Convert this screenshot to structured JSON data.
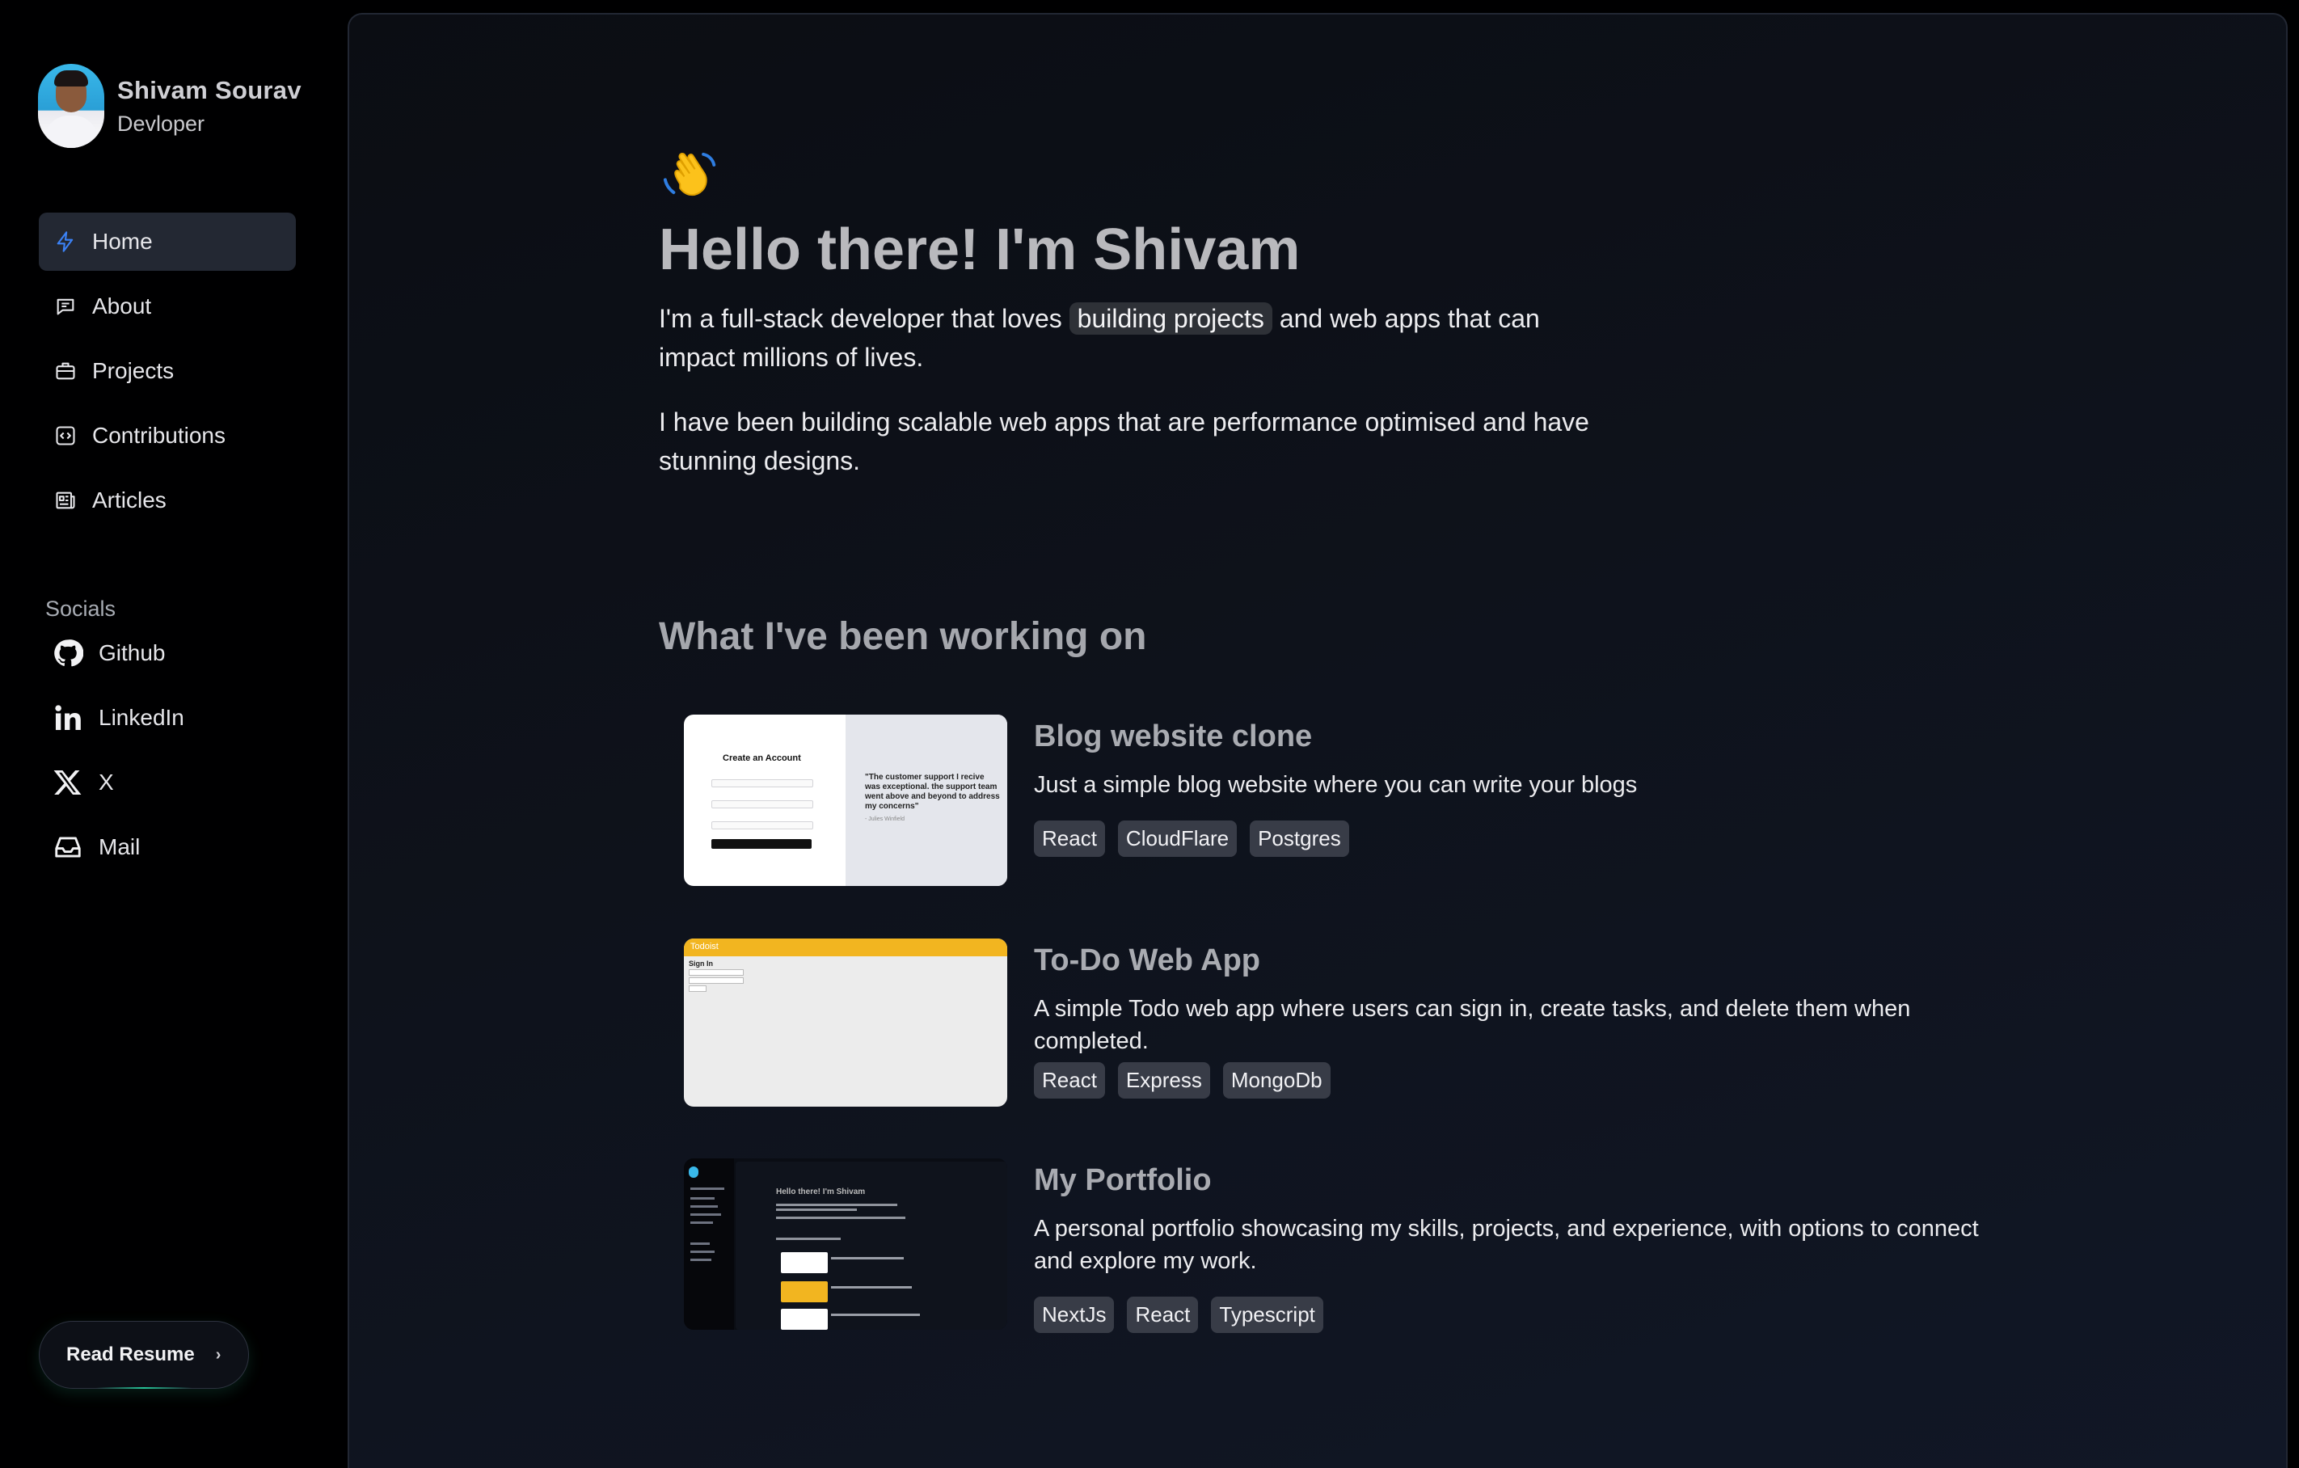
{
  "profile": {
    "name": "Shivam Sourav",
    "role": "Devloper"
  },
  "nav": [
    {
      "label": "Home",
      "icon": "lightning-icon",
      "active": true
    },
    {
      "label": "About",
      "icon": "chat-bubble-icon"
    },
    {
      "label": "Projects",
      "icon": "briefcase-icon"
    },
    {
      "label": "Contributions",
      "icon": "code-square-icon"
    },
    {
      "label": "Articles",
      "icon": "newspaper-icon"
    }
  ],
  "socials": {
    "title": "Socials",
    "items": [
      {
        "label": "Github",
        "icon": "github-icon"
      },
      {
        "label": "LinkedIn",
        "icon": "linkedin-icon"
      },
      {
        "label": "X",
        "icon": "x-icon"
      },
      {
        "label": "Mail",
        "icon": "inbox-icon"
      }
    ]
  },
  "resume": {
    "label": "Read Resume",
    "chevron": "›"
  },
  "hero": {
    "wave": "👋",
    "heading": "Hello there! I'm Shivam",
    "intro_before": "I'm a full-stack developer that loves",
    "intro_highlight": "building projects",
    "intro_after": "and web apps that can impact millions of lives.",
    "intro2": "I have been building scalable web apps that are performance optimised and have stunning designs."
  },
  "working": {
    "title": "What I've been working on",
    "projects": [
      {
        "title": "Blog website clone",
        "description": "Just a simple blog website where you can write your blogs",
        "tags": [
          "React",
          "CloudFlare",
          "Postgres"
        ],
        "thumb": {
          "form_title": "Create an Account",
          "quote": "\"The customer support I recive was exceptional. the support team went above and beyond to address my concerns\"",
          "author": "- Julies Winfield"
        }
      },
      {
        "title": "To-Do Web App",
        "description": "A simple Todo web app where users can sign in, create tasks, and delete them when completed.",
        "tags": [
          "React",
          "Express",
          "MongoDb"
        ],
        "thumb": {
          "brand": "Todoist",
          "heading": "Sign In"
        }
      },
      {
        "title": "My Portfolio",
        "description": "A personal portfolio showcasing my skills, projects, and experience, with options to connect and explore my work.",
        "tags": [
          "NextJs",
          "React",
          "Typescript"
        ],
        "thumb": {
          "heading": "Hello there! I'm Shivam"
        }
      }
    ]
  },
  "colors": {
    "background": "#000001",
    "panel": "#0e121b",
    "accent": "#3b82f6",
    "tag_bg": "#383c47",
    "resume_glow": "#27c59a"
  }
}
